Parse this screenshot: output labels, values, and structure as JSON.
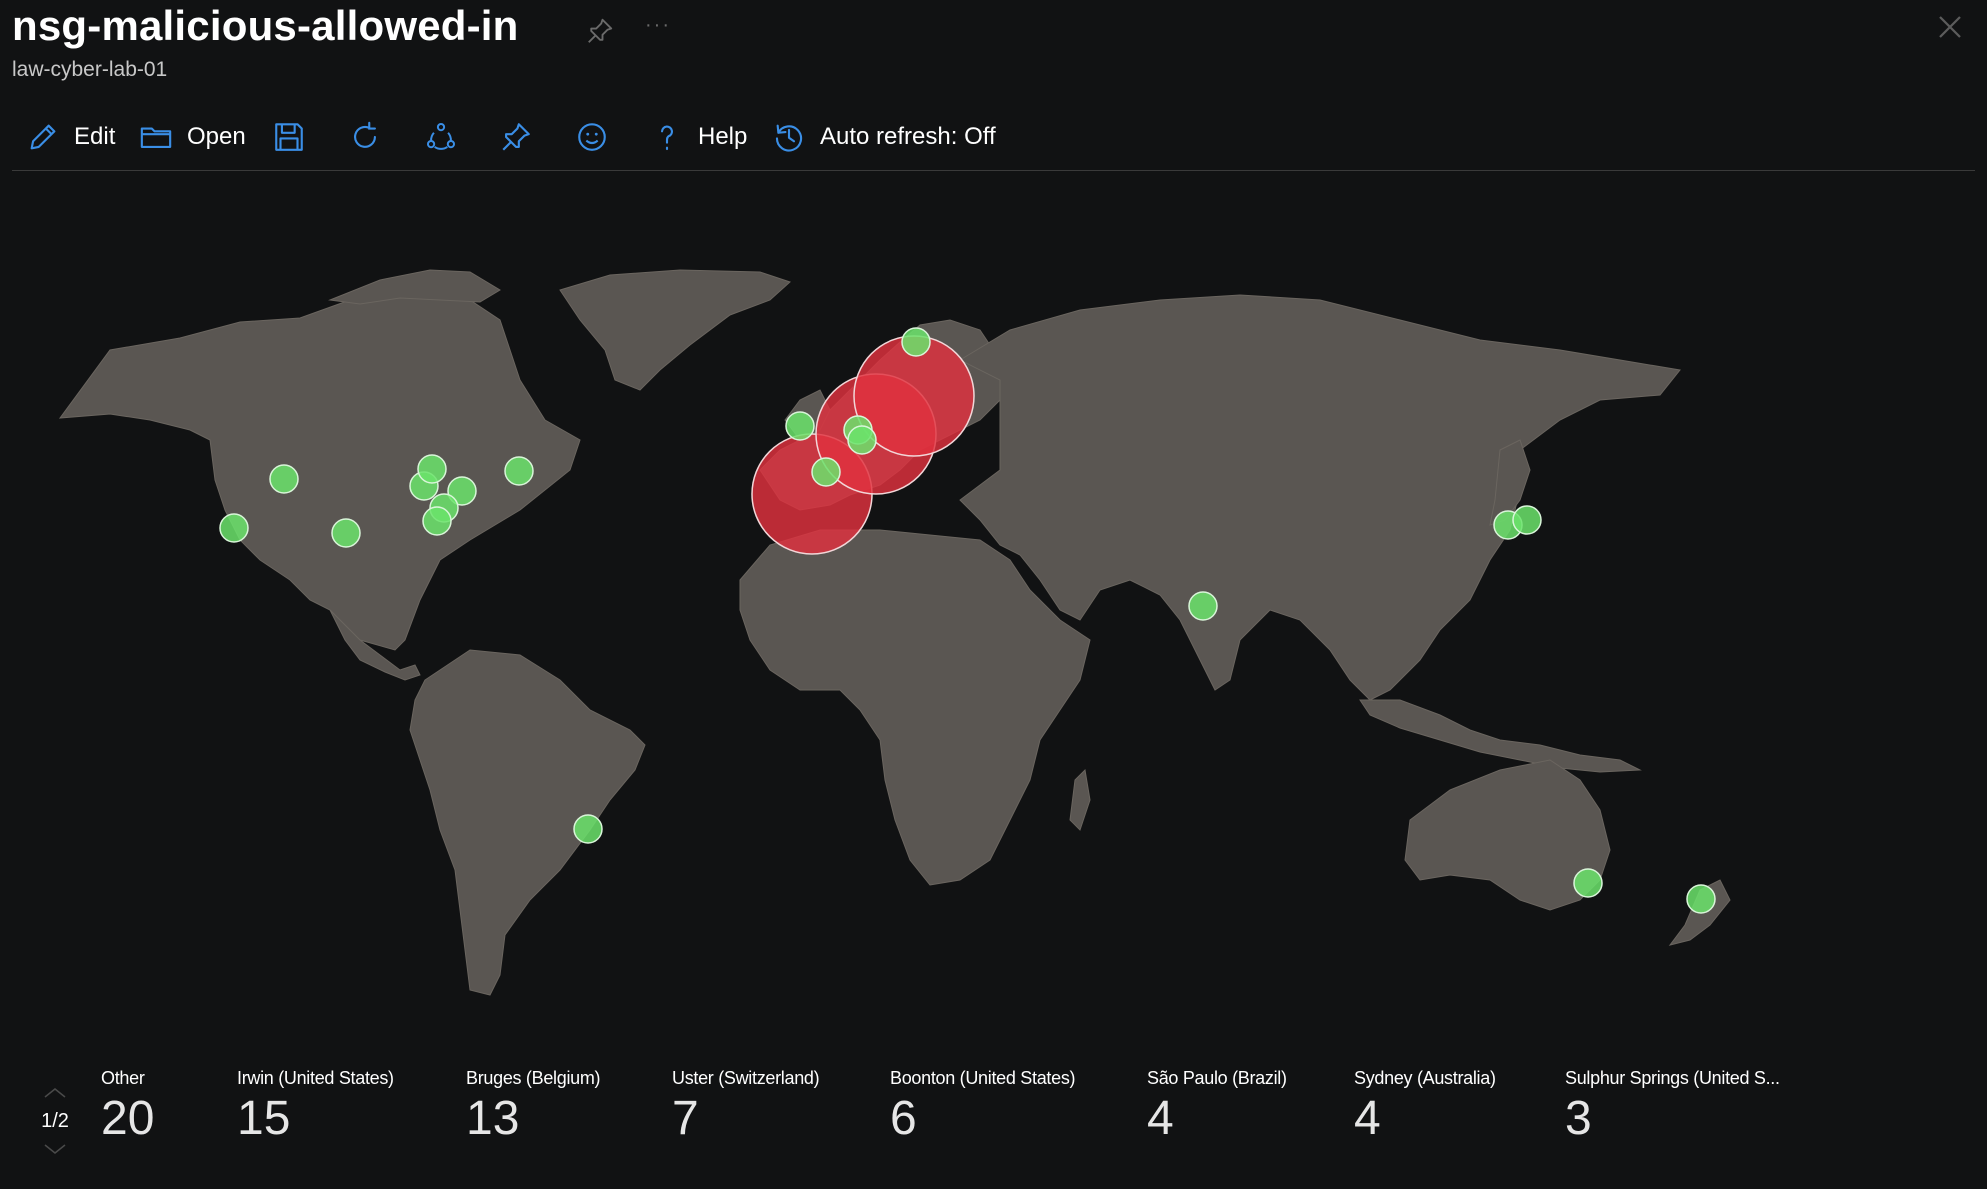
{
  "header": {
    "title": "nsg-malicious-allowed-in",
    "subtitle": "law-cyber-lab-01",
    "pin_icon": "pin-icon",
    "more_label": "···",
    "close_icon": "close-icon"
  },
  "toolbar": {
    "items": [
      {
        "icon": "pencil-icon",
        "label": "Edit"
      },
      {
        "icon": "folder-icon",
        "label": "Open"
      },
      {
        "icon": "save-icon",
        "label": ""
      },
      {
        "icon": "refresh-icon",
        "label": ""
      },
      {
        "icon": "share-icon",
        "label": ""
      },
      {
        "icon": "pin-icon",
        "label": ""
      },
      {
        "icon": "smiley-icon",
        "label": ""
      },
      {
        "icon": "help-icon",
        "label": "Help"
      },
      {
        "icon": "history-icon",
        "label": "Auto refresh: Off"
      }
    ]
  },
  "colors": {
    "background": "#111213",
    "land": "#5a5652",
    "accent": "#3a8ee6",
    "high_marker": "#e0313e",
    "low_marker": "#6be36b"
  },
  "map": {
    "markers": [
      {
        "location": "Spain",
        "severity": "high"
      },
      {
        "location": "Belgium",
        "severity": "high"
      },
      {
        "location": "Germany",
        "severity": "high"
      },
      {
        "location": "Ireland",
        "severity": "low"
      },
      {
        "location": "Norway",
        "severity": "low"
      },
      {
        "location": "Netherlands",
        "severity": "low"
      },
      {
        "location": "Switzerland",
        "severity": "low"
      },
      {
        "location": "Portugal",
        "severity": "low"
      },
      {
        "location": "California",
        "severity": "low"
      },
      {
        "location": "Colorado",
        "severity": "low"
      },
      {
        "location": "Texas",
        "severity": "low"
      },
      {
        "location": "Illinois",
        "severity": "low"
      },
      {
        "location": "Michigan",
        "severity": "low"
      },
      {
        "location": "Ohio",
        "severity": "low"
      },
      {
        "location": "Kentucky",
        "severity": "low"
      },
      {
        "location": "Georgia",
        "severity": "low"
      },
      {
        "location": "New Jersey",
        "severity": "low"
      },
      {
        "location": "Brazil",
        "severity": "low"
      },
      {
        "location": "India",
        "severity": "low"
      },
      {
        "location": "Japan",
        "severity": "low"
      },
      {
        "location": "Japan",
        "severity": "low"
      },
      {
        "location": "Australia",
        "severity": "low"
      },
      {
        "location": "New Zealand",
        "severity": "low"
      }
    ]
  },
  "legend": {
    "page": "1/2",
    "items": [
      {
        "label": "Other",
        "value": "20"
      },
      {
        "label": "Irwin (United States)",
        "value": "15"
      },
      {
        "label": "Bruges (Belgium)",
        "value": "13"
      },
      {
        "label": "Uster (Switzerland)",
        "value": "7"
      },
      {
        "label": "Boonton (United States)",
        "value": "6"
      },
      {
        "label": "São Paulo (Brazil)",
        "value": "4"
      },
      {
        "label": "Sydney (Australia)",
        "value": "4"
      },
      {
        "label": "Sulphur Springs (United S...",
        "value": "3"
      }
    ]
  }
}
